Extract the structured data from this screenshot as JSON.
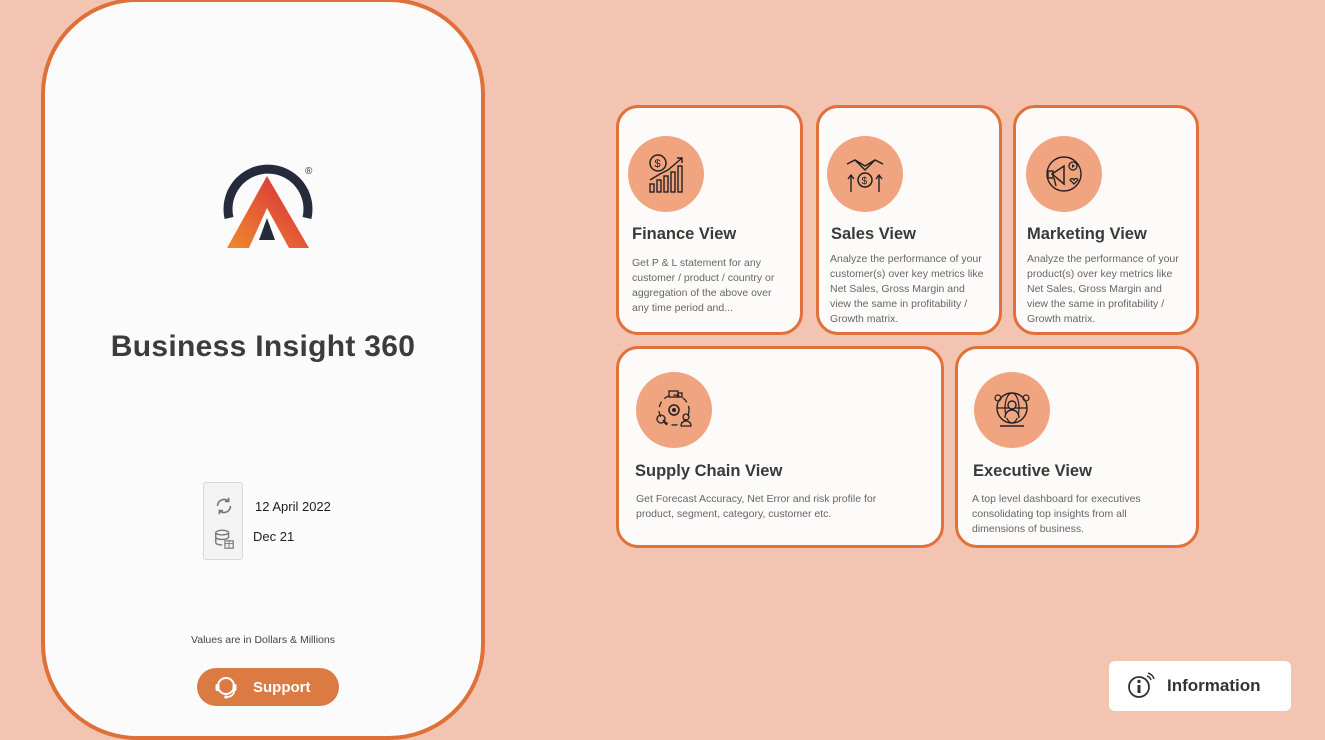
{
  "app": {
    "title": "Business Insight 360",
    "logo_mark": "®"
  },
  "refresh": {
    "last_refresh": "12 April 2022",
    "data_upto": "Dec 21"
  },
  "values_note": "Values are in Dollars & Millions",
  "support": {
    "label": "Support",
    "icon": "headset-icon"
  },
  "cards": [
    {
      "title": "Finance View",
      "icon": "finance-chart-icon",
      "description": "Get P & L statement for any customer / product / country or aggregation of the above over any time period and..."
    },
    {
      "title": "Sales View",
      "icon": "handshake-dollar-icon",
      "description": "Analyze the performance of your customer(s) over key metrics like Net Sales, Gross Margin and view the same in profitability / Growth matrix."
    },
    {
      "title": "Marketing View",
      "icon": "megaphone-icon",
      "description": "Analyze the performance of your product(s) over key metrics like Net Sales, Gross Margin and view the same in profitability / Growth matrix."
    },
    {
      "title": "Supply Chain View",
      "icon": "supply-chain-icon",
      "description": "Get Forecast Accuracy, Net Error and risk profile for product, segment, category, customer etc."
    },
    {
      "title": "Executive View",
      "icon": "executive-globe-icon",
      "description": "A top level dashboard for executives consolidating top insights from all dimensions of business."
    }
  ],
  "information": {
    "label": "Information",
    "icon": "info-icon"
  },
  "colors": {
    "background": "#f3c4b1",
    "accent": "#e07039",
    "icon_circle": "#f1a480",
    "support_button": "#dc7a44"
  }
}
